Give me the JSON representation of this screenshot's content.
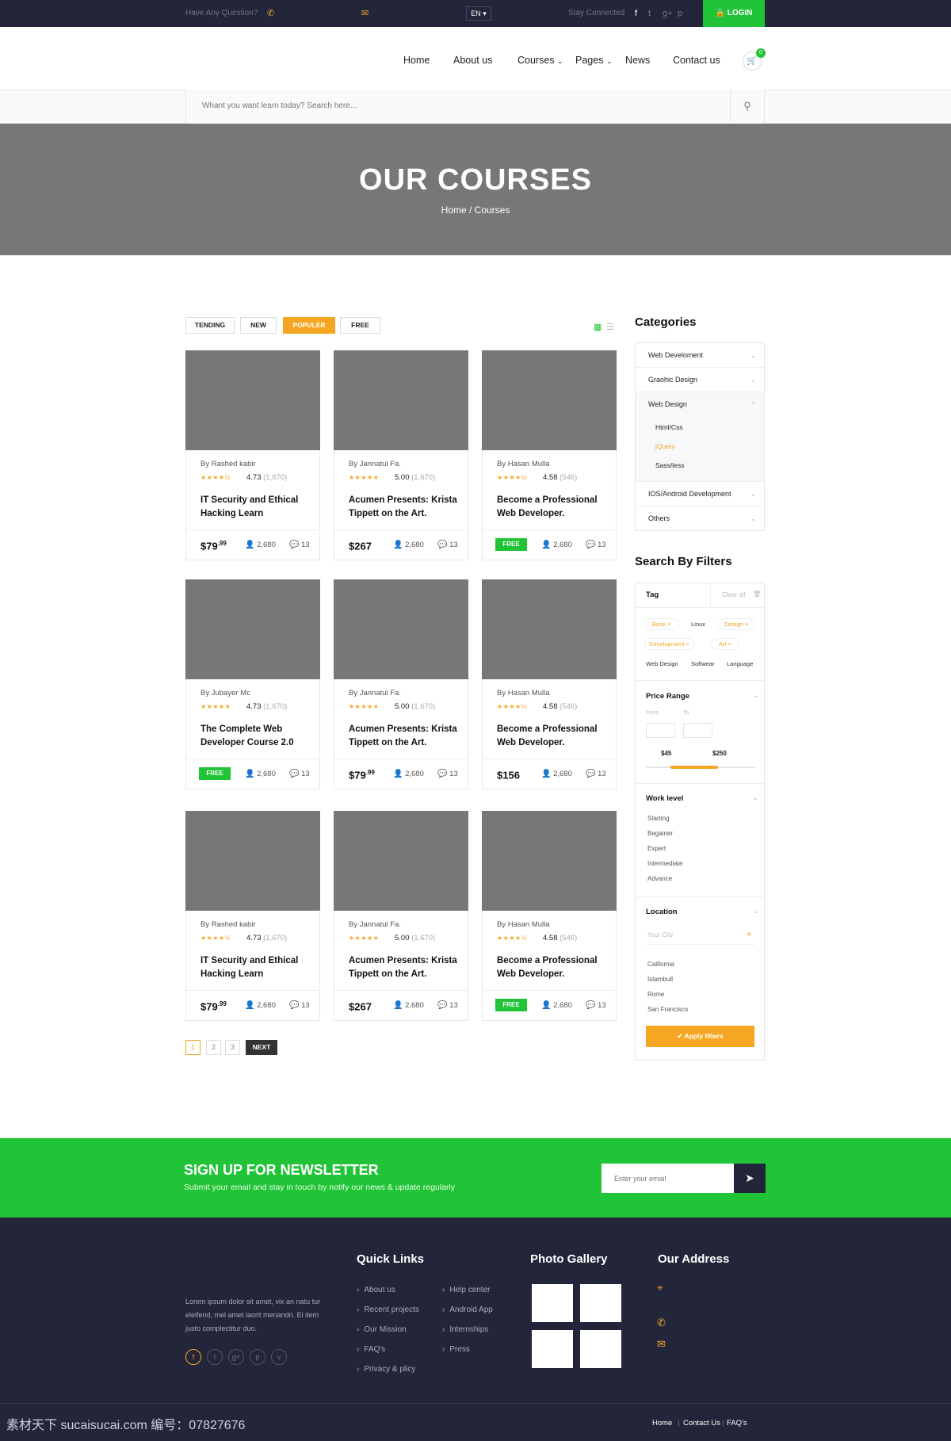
{
  "topbar": {
    "question": "Have Any Question?",
    "phone_icon": "phone-icon",
    "mail_icon": "mail-icon",
    "language": "EN ▾",
    "stay_connected": "Stay Connected",
    "socials": [
      "f",
      "t",
      "g+",
      "p"
    ],
    "login": "LOGIN"
  },
  "nav": {
    "items": [
      "Home",
      "About us",
      "Courses",
      "Pages",
      "News",
      "Contact us"
    ],
    "cart_count": "0"
  },
  "search": {
    "placeholder": "Whant you want learn today? Search here..."
  },
  "hero": {
    "title": "OUR COURSES",
    "breadcrumb": "Home / Courses"
  },
  "tabs": [
    "TENDING",
    "NEW",
    "POPULER",
    "FREE"
  ],
  "courses": [
    {
      "author": "By Rashed kabir",
      "stars": "★★★★½",
      "rating": "4.73",
      "count": "(1,670)",
      "title": "IT Security and Ethical Hacking Learn",
      "price": "$79",
      "cents": ".99",
      "free": false,
      "students": "2,680",
      "comments": "13"
    },
    {
      "author": "By Jannatul Fa.",
      "stars": "★★★★★",
      "rating": "5.00",
      "count": "(1,670)",
      "title": "Acumen Presents: Krista Tippett on the Art.",
      "price": "$267",
      "cents": "",
      "free": false,
      "students": "2,680",
      "comments": "13"
    },
    {
      "author": "By Hasan Mulla",
      "stars": "★★★★½",
      "rating": "4.58",
      "count": "(546)",
      "title": "Become a Professional Web Developer.",
      "price": "FREE",
      "cents": "",
      "free": true,
      "students": "2,680",
      "comments": "13"
    },
    {
      "author": "By Jubayer Mc",
      "stars": "★★★★★",
      "rating": "4.73",
      "count": "(1,670)",
      "title": "The Complete Web Developer Course 2.0",
      "price": "FREE",
      "cents": "",
      "free": true,
      "students": "2,680",
      "comments": "13"
    },
    {
      "author": "By Jannatul Fa.",
      "stars": "★★★★★",
      "rating": "5.00",
      "count": "(1,670)",
      "title": "Acumen Presents: Krista Tippett on the Art.",
      "price": "$79",
      "cents": ".99",
      "free": false,
      "students": "2,680",
      "comments": "13"
    },
    {
      "author": "By Hasan Mulla",
      "stars": "★★★★½",
      "rating": "4.58",
      "count": "(546)",
      "title": "Become a Professional Web Developer.",
      "price": "$156",
      "cents": "",
      "free": false,
      "students": "2,680",
      "comments": "13"
    },
    {
      "author": "By Rashed kabir",
      "stars": "★★★★½",
      "rating": "4.73",
      "count": "(1,670)",
      "title": "IT Security and Ethical Hacking Learn",
      "price": "$79",
      "cents": ".99",
      "free": false,
      "students": "2,680",
      "comments": "13"
    },
    {
      "author": "By Jannatul Fa.",
      "stars": "★★★★★",
      "rating": "5.00",
      "count": "(1,670)",
      "title": "Acumen Presents: Krista Tippett on the Art.",
      "price": "$267",
      "cents": "",
      "free": false,
      "students": "2,680",
      "comments": "13"
    },
    {
      "author": "By Hasan Mulla",
      "stars": "★★★★½",
      "rating": "4.58",
      "count": "(546)",
      "title": "Become a Professional Web Developer.",
      "price": "FREE",
      "cents": "",
      "free": true,
      "students": "2,680",
      "comments": "13"
    }
  ],
  "pagination": {
    "pages": [
      "1",
      "2",
      "3"
    ],
    "next": "NEXT"
  },
  "categories": {
    "title": "Categories",
    "items": [
      "Web Develoment",
      "Graohic Design",
      "Web Design",
      "IOS/Android Development",
      "Others"
    ],
    "subitems": [
      "Html/Css",
      "jQuery",
      "Sass/less"
    ]
  },
  "filters": {
    "title": "Search By Filters",
    "tag_label": "Tag",
    "clear_all": "Clear all",
    "chips": [
      "Book ×",
      "Design ×",
      "Development ×",
      "Art ×"
    ],
    "plain_tags": [
      "Linux",
      "Web Design",
      "Softwear",
      "Language"
    ],
    "price_label": "Price Range",
    "from": "From",
    "to": "To",
    "min": "$45",
    "max": "$250",
    "work_label": "Work level",
    "work_levels": [
      "Starting",
      "Begainer",
      "Expert",
      "Intermediate",
      "Advance"
    ],
    "location_label": "Location",
    "city_placeholder": "Your City",
    "cities": [
      "California",
      "Istambull",
      "Rome",
      "San Francisco"
    ],
    "apply": "✔  Apply filters"
  },
  "newsletter": {
    "title": "SIGN UP FOR NEWSLETTER",
    "subtitle": "Submit your email and stay in touch by notify our news & update regularly",
    "placeholder": "Enter your email"
  },
  "footer": {
    "about": "Lorem ipsum dolor sit amet, vix an natu tur eleifend, mel amet laorit menandri. Ei item justo complectitur duo.",
    "quick_links_title": "Quick Links",
    "links_col1": [
      "About us",
      "Recent projects",
      "Our Mission",
      "FAQ's",
      "Privacy & plicy"
    ],
    "links_col2": [
      "Help center",
      "Android App",
      "Internships",
      "Press"
    ],
    "gallery_title": "Photo Gallery",
    "address_title": "Our Address",
    "socials": [
      "f",
      "t",
      "g+",
      "p",
      "v"
    ],
    "bottom_links": [
      "Home",
      "Contact Us",
      "FAQ's"
    ],
    "watermark": "素材天下 sucaisucai.com   编号：07827676"
  }
}
